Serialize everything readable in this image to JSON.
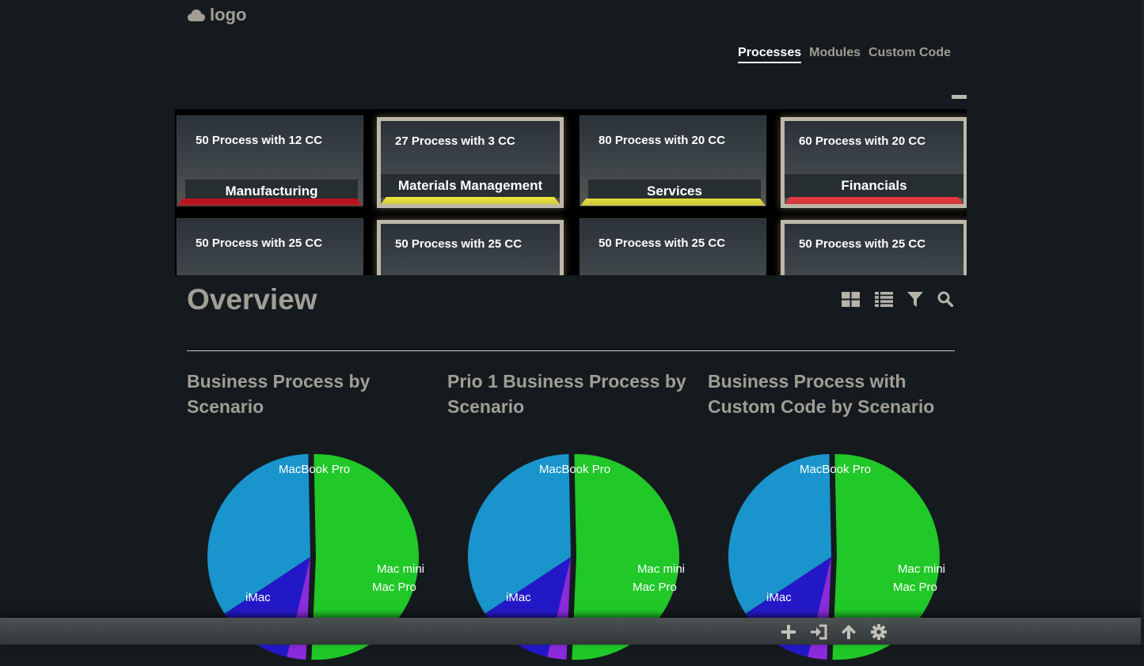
{
  "header": {
    "logo_text": "logo",
    "logo_icon": "cloud-icon"
  },
  "nav": {
    "tabs": [
      {
        "label": "Processes",
        "active": true
      },
      {
        "label": "Modules",
        "active": false
      },
      {
        "label": "Custom Code",
        "active": false
      }
    ]
  },
  "tiles": [
    {
      "subtitle": "50 Process with 12 CC",
      "name": "Manufacturing",
      "status_color": "#c4101c"
    },
    {
      "subtitle": "27 Process with 3 CC",
      "name": "Materials Management",
      "status_color": "#f0e83a"
    },
    {
      "subtitle": "80 Process with 20 CC",
      "name": "Services",
      "status_color": "#e6e03a"
    },
    {
      "subtitle": "60 Process with 20 CC",
      "name": "Financials",
      "status_color": "#e8353a"
    },
    {
      "subtitle": "50 Process with 25 CC"
    },
    {
      "subtitle": "50 Process with 25 CC"
    },
    {
      "subtitle": "50 Process with 25 CC"
    },
    {
      "subtitle": "50 Process with 25 CC"
    }
  ],
  "overview": {
    "title": "Overview",
    "view_icons": [
      "grid-view-icon",
      "list-view-icon",
      "filter-icon",
      "search-icon"
    ]
  },
  "chart_data": [
    {
      "type": "pie",
      "title": "Business Process by Scenario",
      "labels": [
        "MacBook Pro",
        "Mac mini",
        "Mac Pro",
        "iMac"
      ],
      "values": [
        51,
        3,
        12,
        34
      ],
      "colors": [
        "#20c828",
        "#8a2bdc",
        "#2318c8",
        "#1a94cc"
      ]
    },
    {
      "type": "pie",
      "title": "Prio 1 Business Process by Scenario",
      "labels": [
        "MacBook Pro",
        "Mac mini",
        "Mac Pro",
        "iMac"
      ],
      "values": [
        51,
        3,
        12,
        34
      ],
      "colors": [
        "#20c828",
        "#8a2bdc",
        "#2318c8",
        "#1a94cc"
      ]
    },
    {
      "type": "pie",
      "title": "Business Process with Custom Code by Scenario",
      "labels": [
        "MacBook Pro",
        "Mac mini",
        "Mac Pro",
        "iMac"
      ],
      "values": [
        51,
        3,
        12,
        34
      ],
      "colors": [
        "#20c828",
        "#8a2bdc",
        "#2318c8",
        "#1a94cc"
      ]
    }
  ],
  "footer": {
    "icons": [
      "add-icon",
      "sign-in-icon",
      "arrow-up-icon",
      "settings-gear-icon"
    ]
  }
}
